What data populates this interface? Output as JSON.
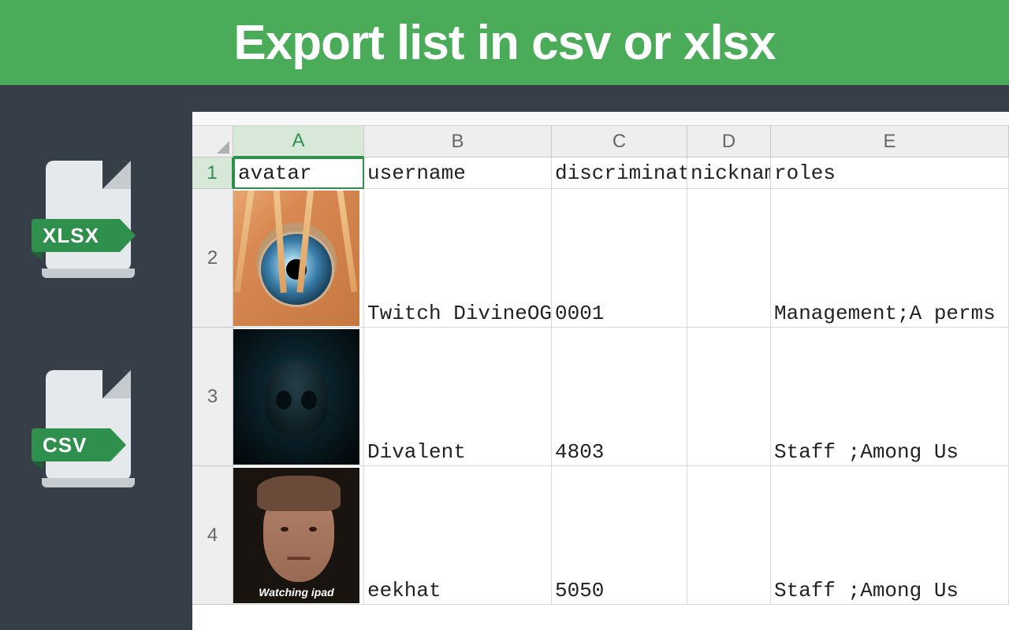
{
  "header": {
    "title": "Export list in csv or xlsx"
  },
  "file_icons": {
    "xlsx_label": "XLSX",
    "csv_label": "CSV"
  },
  "spreadsheet": {
    "columns": [
      "A",
      "B",
      "C",
      "D",
      "E"
    ],
    "row_numbers": [
      "1",
      "2",
      "3",
      "4"
    ],
    "headers": {
      "A": "avatar",
      "B": "username",
      "C": "discriminator",
      "D": "nicknam",
      "E": "roles"
    },
    "rows": [
      {
        "avatar_caption": "",
        "username": "Twitch DivineOG",
        "discriminator": "0001",
        "nickname": "",
        "roles": "Management;A perms"
      },
      {
        "avatar_caption": "",
        "username": "Divalent",
        "discriminator": "4803",
        "nickname": "",
        "roles": " Staff  ;Among Us"
      },
      {
        "avatar_caption": "Watching ipad",
        "username": "eekhat",
        "discriminator": "5050",
        "nickname": "",
        "roles": " Staff  ;Among Us"
      }
    ]
  }
}
